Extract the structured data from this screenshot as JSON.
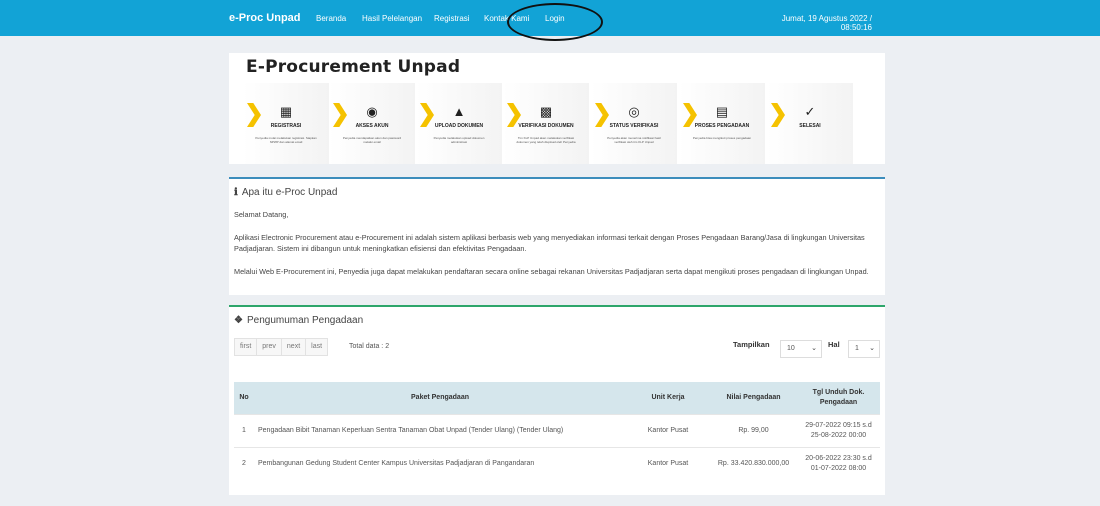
{
  "navbar": {
    "brand": "e-Proc Unpad",
    "items": [
      "Beranda",
      "Hasil Pelelangan",
      "Registrasi",
      "Kontak Kami",
      "Login"
    ],
    "datetime": "Jumat, 19 Agustus 2022 / 08:50:16"
  },
  "banner": {
    "title": "E-Procurement Unpad",
    "steps": [
      {
        "label": "REGISTRASI",
        "icon": "registration-icon",
        "desc": "Penyedia mulai melakukan registrasi. Siapkan NPWP dan alamat email"
      },
      {
        "label": "AKSES AKUN",
        "icon": "account-access-icon",
        "desc": "Penyedia mendapatkan akun dan password melalui email"
      },
      {
        "label": "UPLOAD DOKUMEN",
        "icon": "upload-icon",
        "desc": "Penyedia melakukan upload dokumen administrasi"
      },
      {
        "label": "VERIFIKASI DOKUMEN",
        "icon": "document-verify-icon",
        "desc": "Tim KLP Unpad akan melakukan verifikasi dokumen yang telah diupload oleh Penyedia"
      },
      {
        "label": "STATUS VERIFIKASI",
        "icon": "status-icon",
        "desc": "Penyedia akan menerima notifikasi hasil verifikasi oleh tim KLP Unpad"
      },
      {
        "label": "PROSES PENGADAAN",
        "icon": "procurement-icon",
        "desc": "Penyedia bisa mengikuti proses pengadaan"
      },
      {
        "label": "SELESAI",
        "icon": "check-icon",
        "desc": ""
      }
    ]
  },
  "about": {
    "title": "Apa itu e-Proc Unpad",
    "greeting": "Selamat Datang,",
    "para1": "Aplikasi Electronic Procurement atau e-Procurement ini adalah sistem aplikasi berbasis web yang menyediakan informasi terkait dengan Proses Pengadaan Barang/Jasa di lingkungan Universitas Padjadjaran. Sistem ini dibangun untuk meningkatkan efisiensi dan efektivitas Pengadaan.",
    "para2": "Melalui Web E-Procurement ini, Penyedia juga dapat melakukan pendaftaran secara online sebagai rekanan Universitas Padjadjaran serta dapat mengikuti proses pengadaan di lingkungan Unpad."
  },
  "pengumuman": {
    "title": "Pengumuman Pengadaan",
    "pager": [
      "first",
      "prev",
      "next",
      "last"
    ],
    "total": "Total data : 2",
    "tampilkan_label": "Tampilkan",
    "tampilkan_value": "10",
    "hal_label": "Hal",
    "hal_value": "1",
    "columns": [
      "No",
      "Paket Pengadaan",
      "Unit Kerja",
      "Nilai Pengadaan",
      "Tgl Unduh Dok. Pengadaan"
    ],
    "rows": [
      {
        "no": "1",
        "paket": "Pengadaan Bibit Tanaman Keperluan Sentra Tanaman Obat Unpad (Tender Ulang) (Tender Ulang)",
        "unit": "Kantor Pusat",
        "nilai": "Rp. 99,00",
        "tgl1": "29-07-2022 09:15 s.d",
        "tgl2": "25-08-2022 00:00"
      },
      {
        "no": "2",
        "paket": "Pembangunan Gedung Student Center Kampus Universitas Padjadjaran di Pangandaran",
        "unit": "Kantor Pusat",
        "nilai": "Rp. 33.420.830.000,00",
        "tgl1": "20-06-2022 23:30 s.d",
        "tgl2": "01-07-2022 08:00"
      }
    ]
  },
  "colors": {
    "navbar": "#12a3d6",
    "about_accent": "#3c8dbc",
    "pengumuman_accent": "#2ea66b",
    "chevron": "#f5c200",
    "table_header": "#d5e6ec"
  }
}
